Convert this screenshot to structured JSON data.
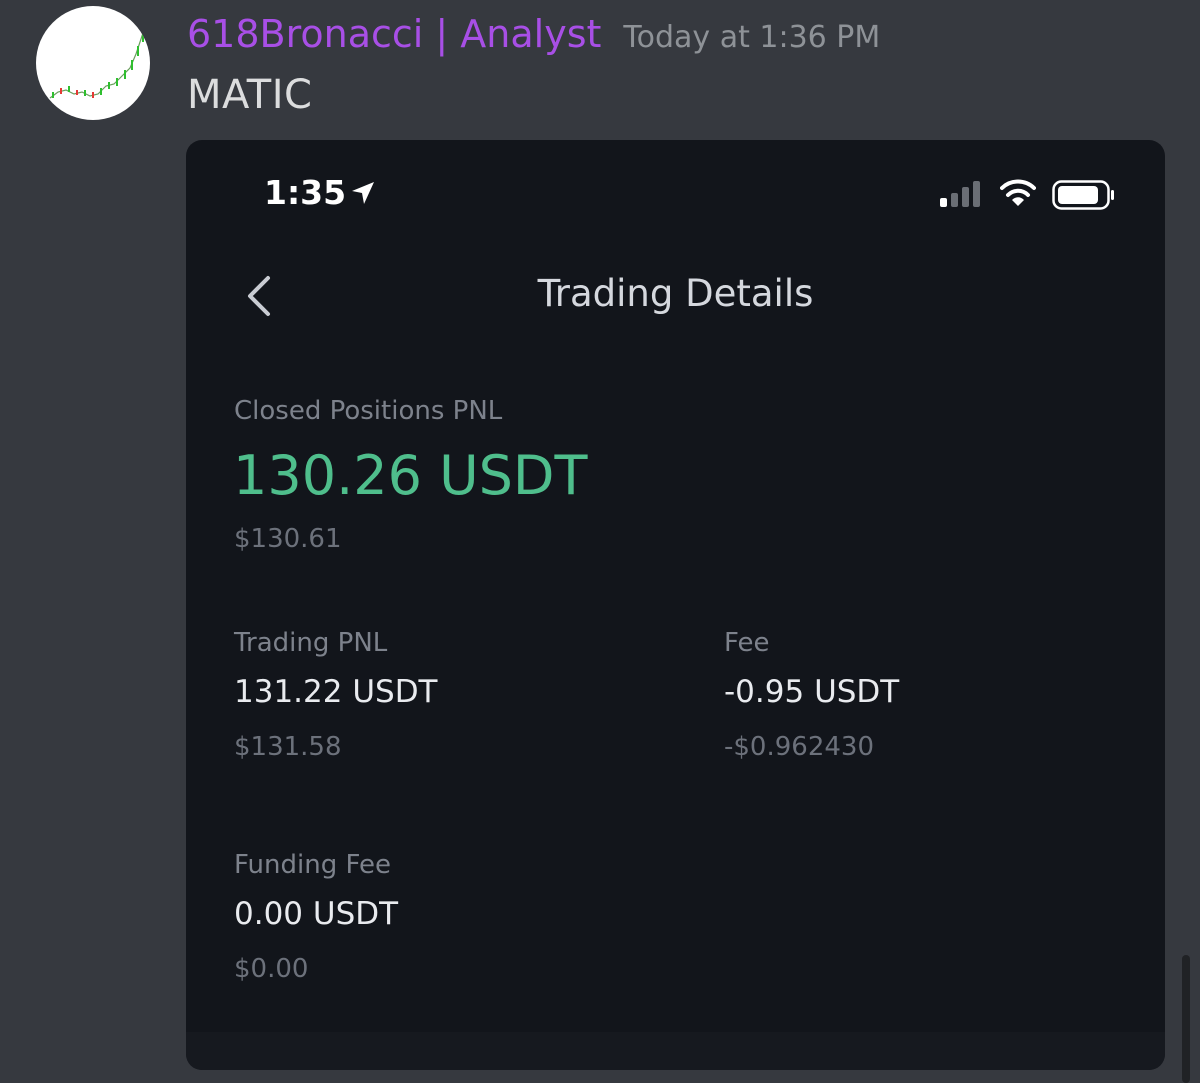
{
  "message": {
    "author": "618Bronacci | Analyst",
    "timestamp": "Today at 1:36 PM",
    "text": "MATIC",
    "author_color": "#a84fe6"
  },
  "phone": {
    "status_bar": {
      "time": "1:35"
    },
    "title": "Trading Details",
    "closed_pnl": {
      "label": "Closed Positions PNL",
      "value": "130.26 USDT",
      "usd": "$130.61",
      "color": "#4fbe8c"
    },
    "trading_pnl": {
      "label": "Trading PNL",
      "value": "131.22 USDT",
      "usd": "$131.58"
    },
    "fee": {
      "label": "Fee",
      "value": "-0.95 USDT",
      "usd": "-$0.962430"
    },
    "funding_fee": {
      "label": "Funding Fee",
      "value": "0.00 USDT",
      "usd": "$0.00"
    }
  },
  "icons": [
    "chart-avatar-icon",
    "location-arrow-icon",
    "cell-signal-icon",
    "wifi-icon",
    "battery-icon",
    "back-chevron-icon"
  ]
}
